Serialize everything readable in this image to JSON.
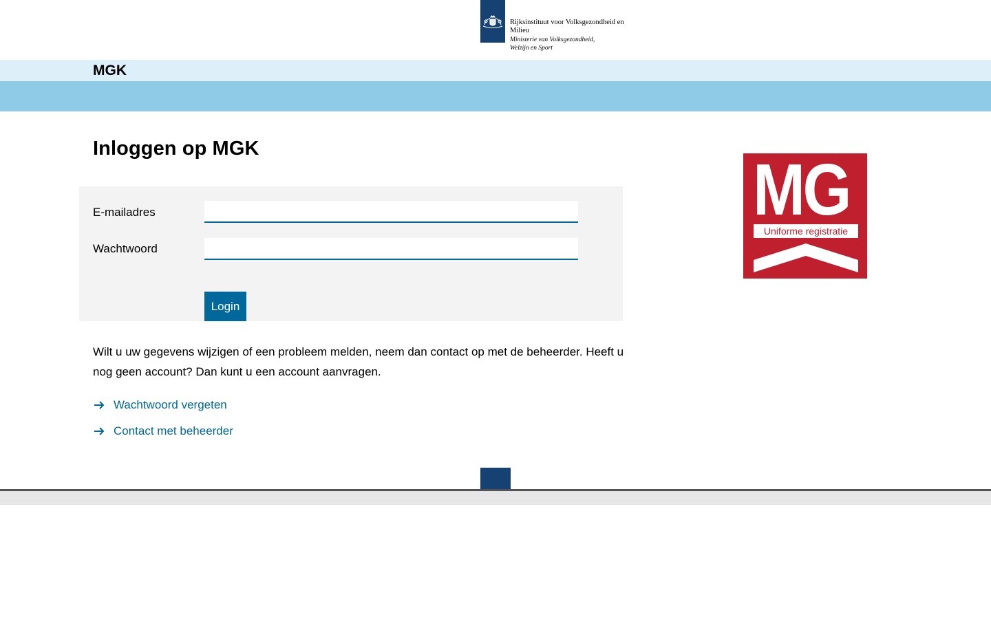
{
  "header": {
    "org_name": "Rijksinstituut voor Volksgezondheid en Milieu",
    "ministry": "Ministerie van Volksgezondheid, Welzijn en Sport",
    "emblem_color": "#154273"
  },
  "appbar": {
    "title": "MGK"
  },
  "main": {
    "title": "Inloggen op MGK",
    "form": {
      "email_label": "E-mailadres",
      "email_value": "",
      "password_label": "Wachtwoord",
      "password_value": "",
      "login_label": "Login"
    },
    "info_text": "Wilt u uw gegevens wijzigen of een probleem melden, neem dan contact op met de beheerder. Heeft u nog geen account? Dan kunt u een account aanvragen.",
    "links": [
      {
        "label": "Wachtwoord vergeten",
        "icon": "arrow-right-icon"
      },
      {
        "label": "Contact met beheerder",
        "icon": "arrow-right-icon"
      }
    ]
  },
  "mg_logo": {
    "letters": "MG",
    "tagline": "Uniforme registratie",
    "color": "#c0202e"
  },
  "colors": {
    "accent": "#01689b",
    "appbar_light": "#ddeff8",
    "appbar_blue": "#8fcae7",
    "panel": "#f3f3f3"
  }
}
